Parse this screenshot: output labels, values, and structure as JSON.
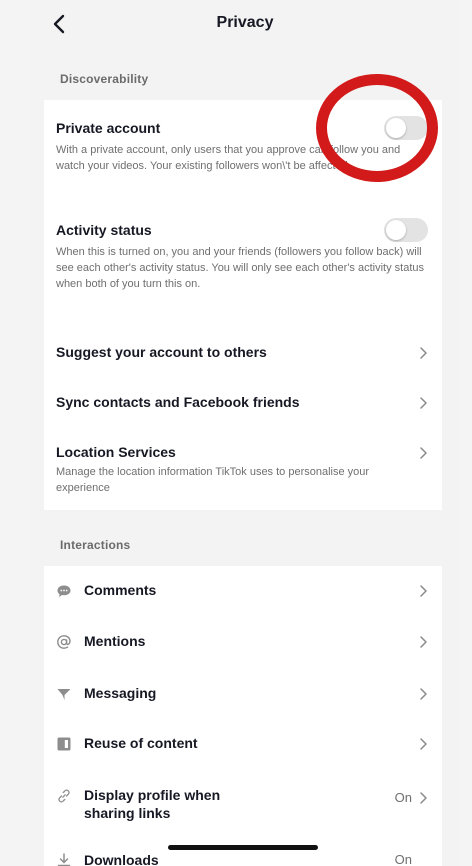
{
  "header": {
    "title": "Privacy"
  },
  "discoverability": {
    "label": "Discoverability",
    "private_account": {
      "title": "Private account",
      "desc": "With a private account, only users that you approve can follow you and watch your videos. Your existing followers won\\'t be affected.",
      "enabled": false
    },
    "activity_status": {
      "title": "Activity status",
      "desc": "When this is turned on, you and your friends (followers you follow back) will see each other's activity status. You will only see each other's activity status when both of you turn this on.",
      "enabled": false
    },
    "suggest": {
      "title": "Suggest your account to others"
    },
    "sync": {
      "title": "Sync contacts and Facebook friends"
    },
    "location": {
      "title": "Location Services",
      "desc": "Manage the location information TikTok uses to personalise your experience"
    }
  },
  "interactions": {
    "label": "Interactions",
    "items": [
      {
        "title": "Comments",
        "icon": "comment-icon"
      },
      {
        "title": "Mentions",
        "icon": "at-icon"
      },
      {
        "title": "Messaging",
        "icon": "send-icon"
      },
      {
        "title": "Reuse of content",
        "icon": "reuse-icon"
      },
      {
        "title": "Display profile when sharing links",
        "value": "On",
        "icon": "link-icon"
      },
      {
        "title": "Downloads",
        "value": "On",
        "icon": "download-icon"
      }
    ]
  },
  "colors": {
    "highlight": "#d21a1a",
    "toggle_off": "#e3e3e3"
  }
}
